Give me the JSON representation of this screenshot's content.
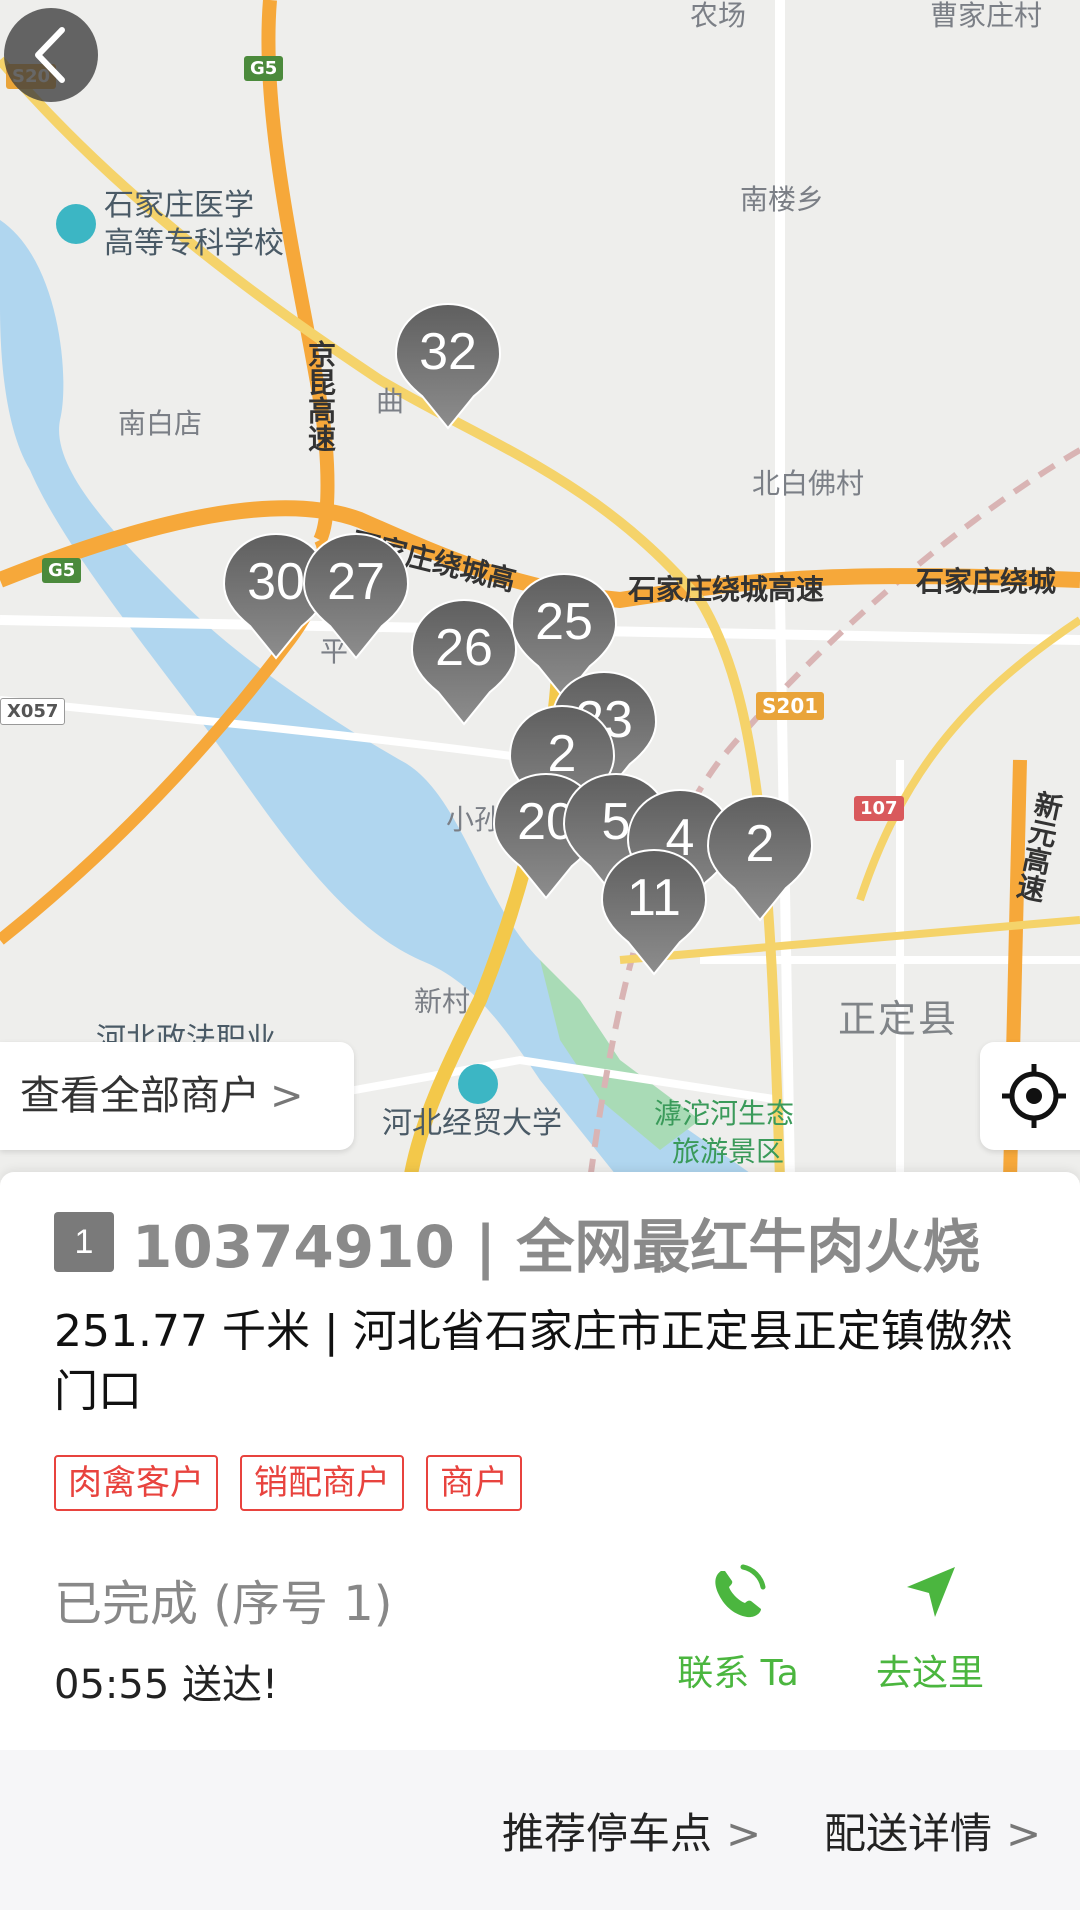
{
  "map": {
    "labels": {
      "nonglchang": "农场",
      "caojia": "曹家庄村",
      "nanlouxiang": "南楼乡",
      "school1": "石家庄医学",
      "school2": "高等专科学校",
      "nanbaidian": "南白店",
      "beibaifo": "北白佛村",
      "jingkun": "京昆高速",
      "qu": "曲",
      "ring1": "石家庄绕城高",
      "ring2": "石家庄绕城高速",
      "ring3": "石家庄绕城",
      "xiaosun": "小孙",
      "xincun": "新村",
      "hebeizhengfa": "河北政法职业",
      "hebeijingmao": "河北经贸大学",
      "hutuo1": "滹沱河生态",
      "hutuo2": "旅游景区",
      "zhengding": "正定县",
      "xinyuan": "新元高速",
      "ping": "平"
    },
    "shields": {
      "g5a": "G5",
      "g5b": "G5",
      "s201": "S201",
      "b107": "107",
      "x057": "X057",
      "s20": "S20"
    },
    "markers": [
      "32",
      "30",
      "27",
      "26",
      "25",
      "23",
      "2",
      "20",
      "5",
      "4",
      "11",
      "2"
    ],
    "view_all_label": "查看全部商户"
  },
  "merchant": {
    "seq": "1",
    "title": "10374910 | 全网最红牛肉火烧",
    "address": "251.77 千米 | 河北省石家庄市正定县正定镇傲然门口",
    "tags": [
      "肉禽客户",
      "销配商户",
      "商户"
    ],
    "status": "已完成 (序号 1)",
    "delivered": "05:55 送达!",
    "contact_label": "联系 Ta",
    "goto_label": "去这里"
  },
  "footer": {
    "parking_label": "推荐停车点",
    "detail_label": "配送详情"
  },
  "colors": {
    "accent_green": "#4bb63f",
    "tag_red": "#e8433e",
    "marker_gray": "#6e6e6e"
  }
}
